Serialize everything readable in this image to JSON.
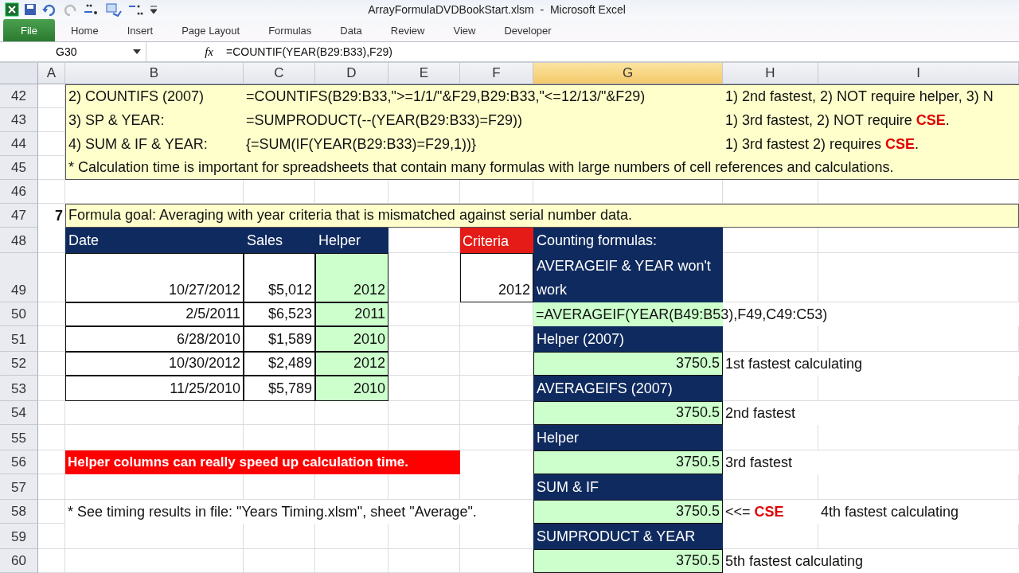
{
  "window": {
    "title": "ArrayFormulaDVDBookStart.xlsm  -  Microsoft Excel"
  },
  "ribbon_tabs": [
    {
      "label": "File",
      "selected": true
    },
    {
      "label": "Home",
      "selected": false
    },
    {
      "label": "Insert",
      "selected": false
    },
    {
      "label": "Page Layout",
      "selected": false
    },
    {
      "label": "Formulas",
      "selected": false
    },
    {
      "label": "Data",
      "selected": false
    },
    {
      "label": "Review",
      "selected": false
    },
    {
      "label": "View",
      "selected": false
    },
    {
      "label": "Developer",
      "selected": false
    }
  ],
  "formula_bar": {
    "name_box": "G30",
    "fx": "fx",
    "formula": "=COUNTIF(YEAR(B29:B33),F29)"
  },
  "columns": [
    {
      "label": "A",
      "selected": false
    },
    {
      "label": "B",
      "selected": false
    },
    {
      "label": "C",
      "selected": false
    },
    {
      "label": "D",
      "selected": false
    },
    {
      "label": "E",
      "selected": false
    },
    {
      "label": "F",
      "selected": false
    },
    {
      "label": "G",
      "selected": true
    },
    {
      "label": "H",
      "selected": false
    },
    {
      "label": "I",
      "selected": false
    }
  ],
  "rows": [
    {
      "number": "42",
      "highlighted": true,
      "cells": {
        "B": {
          "kind": "text",
          "text": "2) COUNTIFS (2007)"
        },
        "C": {
          "kind": "text",
          "text": "=COUNTIFS(B29:B33,\">=1/1/\"&F29,B29:B33,\"<=12/13/\"&F29)"
        },
        "H": {
          "kind": "text",
          "text": "1) 2nd fastest, 2) NOT require helper, 3) N"
        }
      }
    },
    {
      "number": "43",
      "highlighted": true,
      "cells": {
        "B": {
          "kind": "text",
          "text": "3) SP & YEAR:"
        },
        "C": {
          "kind": "text",
          "text": "=SUMPRODUCT(--(YEAR(B29:B33)=F29))"
        },
        "H": {
          "kind": "text",
          "text": "1) 3rd fastest, 2) NOT require **CSE**."
        }
      }
    },
    {
      "number": "44",
      "highlighted": true,
      "cells": {
        "B": {
          "kind": "text",
          "text": "4) SUM & IF & YEAR:"
        },
        "C": {
          "kind": "text",
          "text": "{=SUM(IF(YEAR(B29:B33)=F29,1))}"
        },
        "H": {
          "kind": "text",
          "text": "1) 3rd fastest 2) requires **CSE**."
        }
      }
    },
    {
      "number": "45",
      "highlighted": true,
      "cells": {
        "B": {
          "kind": "text",
          "text": "* Calculation time is important for spreadsheets that contain many formulas with large numbers of cell references and calculations."
        }
      }
    },
    {
      "number": "46",
      "highlighted": false,
      "cells": {}
    },
    {
      "number": "47",
      "highlighted": true,
      "cells": {
        "A": {
          "kind": "step",
          "text": "7"
        },
        "B": {
          "kind": "goal",
          "text": "Formula goal: Averaging with year criteria that is mismatched against serial number data."
        }
      }
    },
    {
      "number": "48",
      "highlighted": false,
      "cells": {
        "B": {
          "kind": "header",
          "text": "Date"
        },
        "C": {
          "kind": "header",
          "text": "Sales"
        },
        "D": {
          "kind": "header",
          "text": "Helper"
        },
        "F": {
          "kind": "criteria",
          "text": "Criteria"
        },
        "G": {
          "kind": "header",
          "text": "Counting formulas:"
        }
      }
    },
    {
      "number": "49",
      "highlighted": false,
      "cells": {
        "B": {
          "kind": "number",
          "text": "10/27/2012"
        },
        "C": {
          "kind": "number",
          "text": "$5,012"
        },
        "D": {
          "kind": "helper",
          "text": "2012"
        },
        "F": {
          "kind": "input",
          "text": "2012"
        },
        "G": {
          "kind": "header",
          "text": "AVERAGEIF & YEAR won't work"
        }
      }
    },
    {
      "number": "50",
      "highlighted": false,
      "cells": {
        "B": {
          "kind": "number",
          "text": "2/5/2011"
        },
        "C": {
          "kind": "number",
          "text": "$6,523"
        },
        "D": {
          "kind": "helper",
          "text": "2011"
        },
        "G": {
          "kind": "formula",
          "text": "=AVERAGEIF(YEAR(B49:B53),F49,C49:C53)"
        }
      }
    },
    {
      "number": "51",
      "highlighted": false,
      "cells": {
        "B": {
          "kind": "number",
          "text": "6/28/2010"
        },
        "C": {
          "kind": "number",
          "text": "$1,589"
        },
        "D": {
          "kind": "helper",
          "text": "2010"
        },
        "G": {
          "kind": "header",
          "text": "Helper (2007)"
        }
      }
    },
    {
      "number": "52",
      "highlighted": false,
      "cells": {
        "B": {
          "kind": "number",
          "text": "10/30/2012"
        },
        "C": {
          "kind": "number",
          "text": "$2,489"
        },
        "D": {
          "kind": "helper",
          "text": "2012"
        },
        "G": {
          "kind": "result",
          "text": "3750.5"
        },
        "H": {
          "kind": "text",
          "text": "1st fastest calculating"
        }
      }
    },
    {
      "number": "53",
      "highlighted": false,
      "cells": {
        "B": {
          "kind": "number",
          "text": "11/25/2010"
        },
        "C": {
          "kind": "number",
          "text": "$5,789"
        },
        "D": {
          "kind": "helper",
          "text": "2010"
        },
        "G": {
          "kind": "header",
          "text": "AVERAGEIFS (2007)"
        }
      }
    },
    {
      "number": "54",
      "highlighted": false,
      "cells": {
        "G": {
          "kind": "result",
          "text": "3750.5"
        },
        "H": {
          "kind": "text",
          "text": "2nd fastest"
        }
      }
    },
    {
      "number": "55",
      "highlighted": false,
      "cells": {
        "G": {
          "kind": "header",
          "text": "Helper"
        }
      }
    },
    {
      "number": "56",
      "highlighted": false,
      "cells": {
        "B": {
          "kind": "banner",
          "text": "Helper columns can really speed up calculation time."
        },
        "G": {
          "kind": "result",
          "text": "3750.5"
        },
        "H": {
          "kind": "text",
          "text": "3rd fastest"
        }
      }
    },
    {
      "number": "57",
      "highlighted": false,
      "cells": {
        "G": {
          "kind": "header",
          "text": "SUM & IF"
        }
      }
    },
    {
      "number": "58",
      "highlighted": false,
      "cells": {
        "B": {
          "kind": "text",
          "text": "* See timing results in file: \"Years Timing.xlsm\", sheet \"Average\"."
        },
        "G": {
          "kind": "result",
          "text": "3750.5"
        },
        "H": {
          "kind": "text",
          "text": " <<= **CSE**"
        },
        "I": {
          "kind": "text",
          "text": "4th fastest calculating"
        }
      }
    },
    {
      "number": "59",
      "highlighted": false,
      "cells": {
        "G": {
          "kind": "header",
          "text": "SUMPRODUCT & YEAR"
        }
      }
    },
    {
      "number": "60",
      "highlighted": false,
      "cells": {
        "G": {
          "kind": "result",
          "text": "3750.5"
        },
        "H": {
          "kind": "text",
          "text": "5th fastest calculating"
        }
      }
    }
  ]
}
